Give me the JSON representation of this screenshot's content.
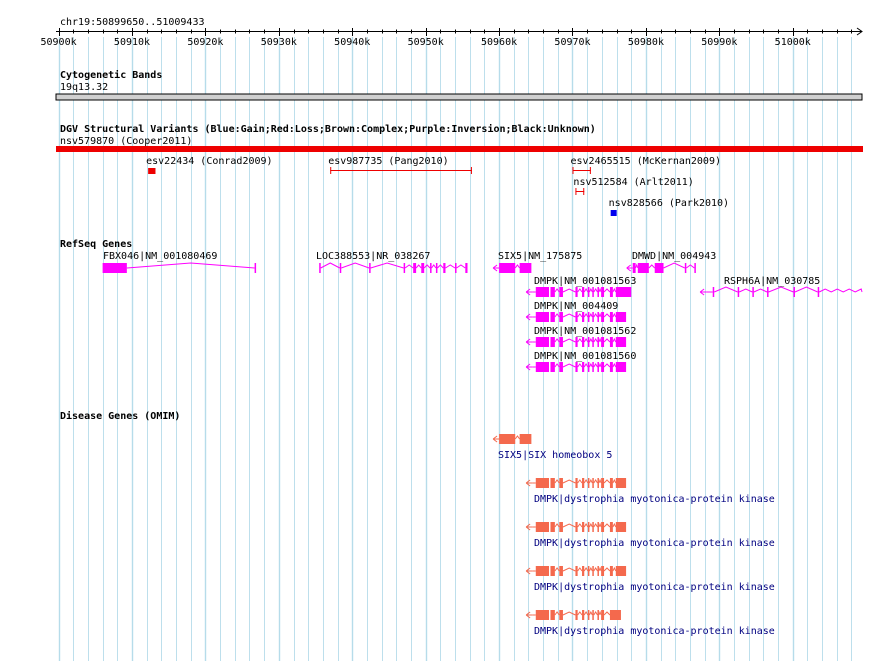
{
  "ruler": {
    "range_label": "chr19:50899650..51009433",
    "ticks": [
      "50900k",
      "50910k",
      "50920k",
      "50930k",
      "50940k",
      "50950k",
      "50960k",
      "50970k",
      "50980k",
      "50990k",
      "51000k"
    ]
  },
  "tracks": {
    "cytoband": {
      "title": "Cytogenetic Bands",
      "band_label": "19q13.32"
    },
    "dgv": {
      "title": "DGV Structural Variants (Blue:Gain;Red:Loss;Brown:Complex;Purple:Inversion;Black:Unknown)",
      "variants": [
        {
          "label": "nsv579870 (Cooper2011)",
          "start": 50899650,
          "end": 51009433,
          "type": "loss"
        },
        {
          "label": "esv22434 (Conrad2009)",
          "start": 50912200,
          "end": 50913200,
          "type": "loss"
        },
        {
          "label": "esv987735 (Pang2010)",
          "start": 50937000,
          "end": 50956300,
          "type": "loss"
        },
        {
          "label": "esv2465515 (McKernan2009)",
          "start": 50970000,
          "end": 50972500,
          "type": "loss"
        },
        {
          "label": "nsv512584 (Arlt2011)",
          "start": 50970400,
          "end": 50971600,
          "type": "loss"
        },
        {
          "label": "nsv828566 (Park2010)",
          "start": 50975200,
          "end": 50976000,
          "type": "gain"
        }
      ]
    },
    "refseq": {
      "title": "RefSeq Genes",
      "genes": [
        {
          "label": "FBX046|NM_001080469",
          "start": 50906000,
          "end": 50926900,
          "strand": "+",
          "exons": [
            [
              50906000,
              50909300
            ],
            [
              50926700,
              50926900
            ]
          ]
        },
        {
          "label": "LOC388553|NR_038267",
          "start": 50935500,
          "end": 50955700,
          "strand": "+",
          "exons": [
            [
              50935500,
              50935700
            ],
            [
              50938300,
              50938500
            ],
            [
              50942300,
              50942500
            ],
            [
              50947000,
              50947200
            ],
            [
              50948300,
              50948700
            ],
            [
              50949400,
              50949800
            ],
            [
              50950600,
              50950800
            ],
            [
              50951400,
              50951600
            ],
            [
              50952400,
              50952700
            ],
            [
              50954000,
              50954200
            ],
            [
              50955400,
              50955700
            ]
          ]
        },
        {
          "label": "SIX5|NM_175875",
          "start": 50960000,
          "end": 50964400,
          "strand": "-",
          "exons": [
            [
              50960000,
              50962200
            ],
            [
              50962800,
              50964400
            ]
          ]
        },
        {
          "label": "DMWD|NM_004943",
          "start": 50978200,
          "end": 50986800,
          "strand": "-",
          "exons": [
            [
              50978200,
              50978600
            ],
            [
              50978900,
              50980400
            ],
            [
              50981200,
              50982400
            ],
            [
              50985300,
              50985500
            ],
            [
              50986600,
              50986800
            ]
          ]
        },
        {
          "label": "DMPK|NM_001081563",
          "start": 50964500,
          "end": 50978000,
          "strand": "-",
          "exons": [
            [
              50965000,
              50966800
            ],
            [
              50967000,
              50967600
            ],
            [
              50968200,
              50968700
            ],
            [
              50970400,
              50970700
            ],
            [
              50971300,
              50971600
            ],
            [
              50972100,
              50972300
            ],
            [
              50972700,
              50972900
            ],
            [
              50973400,
              50973600
            ],
            [
              50973900,
              50974300
            ],
            [
              50975100,
              50975500
            ],
            [
              50975900,
              50978000
            ]
          ]
        },
        {
          "label": "DMPK|NM_004409",
          "start": 50964500,
          "end": 50977300,
          "strand": "-",
          "exons": [
            [
              50965000,
              50966800
            ],
            [
              50967000,
              50967600
            ],
            [
              50968200,
              50968700
            ],
            [
              50970400,
              50970700
            ],
            [
              50971300,
              50971600
            ],
            [
              50972100,
              50972300
            ],
            [
              50972700,
              50972900
            ],
            [
              50973400,
              50973600
            ],
            [
              50973900,
              50974300
            ],
            [
              50975100,
              50975500
            ],
            [
              50975900,
              50977300
            ]
          ]
        },
        {
          "label": "DMPK|NM_001081562",
          "start": 50964500,
          "end": 50977300,
          "strand": "-",
          "exons": [
            [
              50965000,
              50966800
            ],
            [
              50967000,
              50967600
            ],
            [
              50968200,
              50968700
            ],
            [
              50970400,
              50970700
            ],
            [
              50971300,
              50971600
            ],
            [
              50972100,
              50972300
            ],
            [
              50972700,
              50972900
            ],
            [
              50973400,
              50973600
            ],
            [
              50973900,
              50974300
            ],
            [
              50975100,
              50975500
            ],
            [
              50975900,
              50977300
            ]
          ]
        },
        {
          "label": "DMPK|NM_001081560",
          "start": 50964500,
          "end": 50977300,
          "strand": "-",
          "exons": [
            [
              50965000,
              50966800
            ],
            [
              50967000,
              50967600
            ],
            [
              50968200,
              50968700
            ],
            [
              50970400,
              50970700
            ],
            [
              50971300,
              50971600
            ],
            [
              50972100,
              50972300
            ],
            [
              50972700,
              50972900
            ],
            [
              50973400,
              50973600
            ],
            [
              50973900,
              50974300
            ],
            [
              50975100,
              50975500
            ],
            [
              50975900,
              50977300
            ]
          ]
        },
        {
          "label": "RSPH6A|NM_030785",
          "start": 50988200,
          "end": 51009433,
          "strand": "-",
          "exons": [
            [
              50989100,
              50989300
            ],
            [
              50992500,
              50992700
            ],
            [
              50994500,
              50994700
            ],
            [
              50996500,
              50996700
            ],
            [
              51000100,
              51000300
            ],
            [
              51003400,
              51003600
            ]
          ]
        }
      ]
    },
    "omim": {
      "title": "Disease Genes (OMIM)",
      "genes": [
        {
          "label": "SIX5|SIX homeobox 5",
          "start": 50960000,
          "end": 50964400,
          "strand": "-",
          "exons": [
            [
              50960000,
              50962200
            ],
            [
              50962800,
              50964400
            ]
          ]
        },
        {
          "label": "DMPK|dystrophia myotonica-protein kinase",
          "start": 50964500,
          "end": 50977300,
          "strand": "-",
          "exons": [
            [
              50965000,
              50966800
            ],
            [
              50967000,
              50967600
            ],
            [
              50968200,
              50968700
            ],
            [
              50970400,
              50970700
            ],
            [
              50971300,
              50971600
            ],
            [
              50972100,
              50972300
            ],
            [
              50972700,
              50972900
            ],
            [
              50973400,
              50973600
            ],
            [
              50973900,
              50974300
            ],
            [
              50975100,
              50975500
            ],
            [
              50975900,
              50977300
            ]
          ]
        },
        {
          "label": "DMPK|dystrophia myotonica-protein kinase",
          "start": 50964500,
          "end": 50977300,
          "strand": "-",
          "exons": [
            [
              50965000,
              50966800
            ],
            [
              50967000,
              50967600
            ],
            [
              50968200,
              50968700
            ],
            [
              50970400,
              50970700
            ],
            [
              50971300,
              50971600
            ],
            [
              50972100,
              50972300
            ],
            [
              50972700,
              50972900
            ],
            [
              50973400,
              50973600
            ],
            [
              50973900,
              50974300
            ],
            [
              50975100,
              50975500
            ],
            [
              50975900,
              50977300
            ]
          ]
        },
        {
          "label": "DMPK|dystrophia myotonica-protein kinase",
          "start": 50964500,
          "end": 50977300,
          "strand": "-",
          "exons": [
            [
              50965000,
              50966800
            ],
            [
              50967000,
              50967600
            ],
            [
              50968200,
              50968700
            ],
            [
              50970400,
              50970700
            ],
            [
              50971300,
              50971600
            ],
            [
              50972100,
              50972300
            ],
            [
              50972700,
              50972900
            ],
            [
              50973400,
              50973600
            ],
            [
              50973900,
              50974300
            ],
            [
              50975100,
              50975500
            ],
            [
              50975900,
              50977300
            ]
          ]
        },
        {
          "label": "DMPK|dystrophia myotonica-protein kinase",
          "start": 50964500,
          "end": 50976600,
          "strand": "-",
          "exons": [
            [
              50965000,
              50966800
            ],
            [
              50967000,
              50967600
            ],
            [
              50968200,
              50968700
            ],
            [
              50970400,
              50970700
            ],
            [
              50971300,
              50971600
            ],
            [
              50972100,
              50972300
            ],
            [
              50972700,
              50972900
            ],
            [
              50973400,
              50973600
            ],
            [
              50973900,
              50974300
            ],
            [
              50975100,
              50976600
            ]
          ]
        }
      ]
    }
  },
  "colors": {
    "gridline": "#b6dcea",
    "refseq": "#ff00ff",
    "omim": "#f4694d",
    "loss": "#ee0000",
    "gain": "#0000ee",
    "label": "#000000",
    "omim_label": "#000080"
  }
}
